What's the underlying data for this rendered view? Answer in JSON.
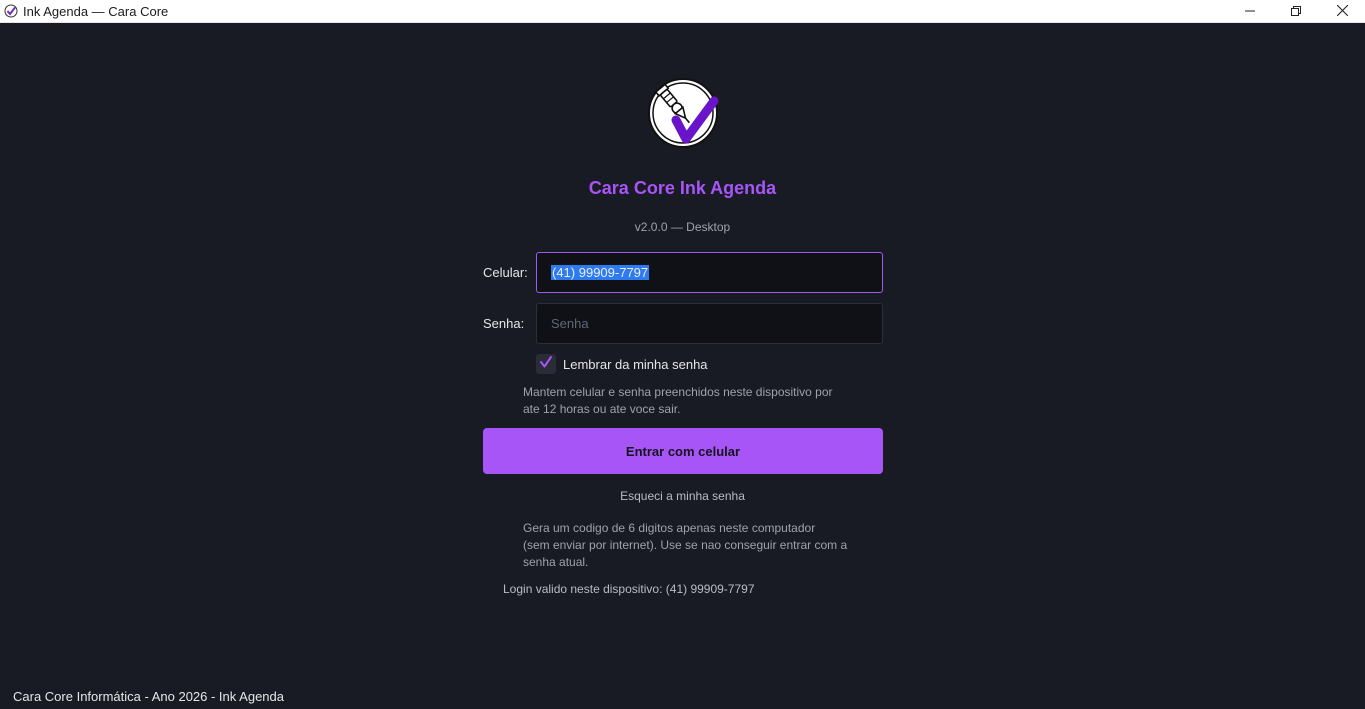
{
  "window": {
    "title": "Ink Agenda — Cara Core",
    "icons": {
      "app": "app-logo-icon",
      "minimize": "minimize-icon",
      "maximize": "restore-icon",
      "close": "close-icon"
    }
  },
  "branding": {
    "logo": "tattoo-machine-check-logo",
    "title": "Cara Core Ink Agenda",
    "version": "v2.0.0 — Desktop",
    "accent_color": "#a855f7"
  },
  "form": {
    "phone_label": "Celular:",
    "phone_value": "(41) 99909-7797",
    "password_label": "Senha:",
    "password_placeholder": "Senha",
    "remember_label": "Lembrar da minha senha",
    "remember_checked": true,
    "remember_help": [
      "Mantem celular e senha preenchidos neste dispositivo por",
      "ate 12 horas ou ate voce sair."
    ],
    "submit_label": "Entrar com celular",
    "forgot_label": "Esqueci a minha senha",
    "forgot_help": [
      "Gera um codigo de 6 digitos apenas neste computador",
      "(sem enviar por internet). Use se nao conseguir entrar com a",
      "senha atual."
    ],
    "session_note": "Login valido neste dispositivo: (41) 99909-7797"
  },
  "footer": {
    "text": "Cara Core Informática - Ano 2026 - Ink Agenda"
  }
}
